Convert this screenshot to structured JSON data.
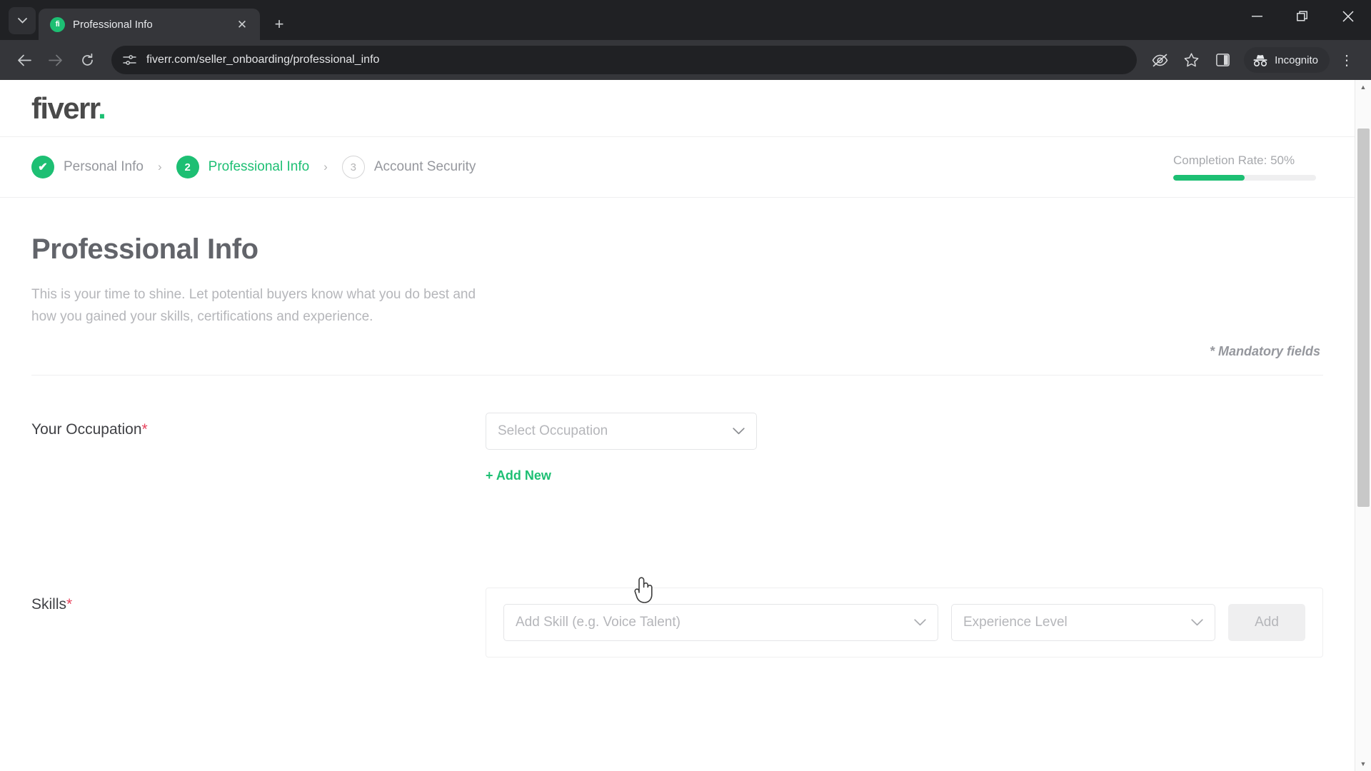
{
  "browser": {
    "tab": {
      "title": "Professional Info",
      "favicon_text": "fi",
      "favicon_name": "fiverr-favicon"
    },
    "tab_list_icon": "chevron-down-icon",
    "close_tab_icon": "✕",
    "new_tab_icon": "+",
    "window": {
      "minimize": "—",
      "restore": "❐",
      "close": "✕"
    },
    "nav": {
      "back": "←",
      "forward": "→",
      "reload": "⟳"
    },
    "omnibox": {
      "url": "fiverr.com/seller_onboarding/professional_info",
      "site_icon": "tune-icon"
    },
    "toolbar_icons": [
      "eye-off-icon",
      "bookmark-star-icon",
      "side-panel-icon"
    ],
    "incognito": {
      "label": "Incognito",
      "icon": "incognito-icon"
    },
    "menu_icon": "⋮"
  },
  "header": {
    "logo": "fiverr",
    "logo_dot": ".",
    "brand_color": "#1dbf73"
  },
  "stepper": {
    "separator": "›",
    "steps": [
      {
        "badge": "✔",
        "label": "Personal Info",
        "state": "done"
      },
      {
        "badge": "2",
        "label": "Professional Info",
        "state": "active"
      },
      {
        "badge": "3",
        "label": "Account Security",
        "state": "todo"
      }
    ]
  },
  "completion": {
    "text": "Completion Rate: 50%",
    "percent": 50
  },
  "main": {
    "title": "Professional Info",
    "description": "This is your time to shine. Let potential buyers know what you do best and how you gained your skills, certifications and experience.",
    "mandatory_note": "* Mandatory fields"
  },
  "occupation": {
    "label": "Your Occupation",
    "required_mark": "*",
    "placeholder": "Select Occupation",
    "add_new_label": "+ Add New"
  },
  "skills": {
    "label": "Skills",
    "required_mark": "*",
    "skill_placeholder": "Add Skill (e.g. Voice Talent)",
    "level_placeholder": "Experience Level",
    "add_button": "Add"
  }
}
